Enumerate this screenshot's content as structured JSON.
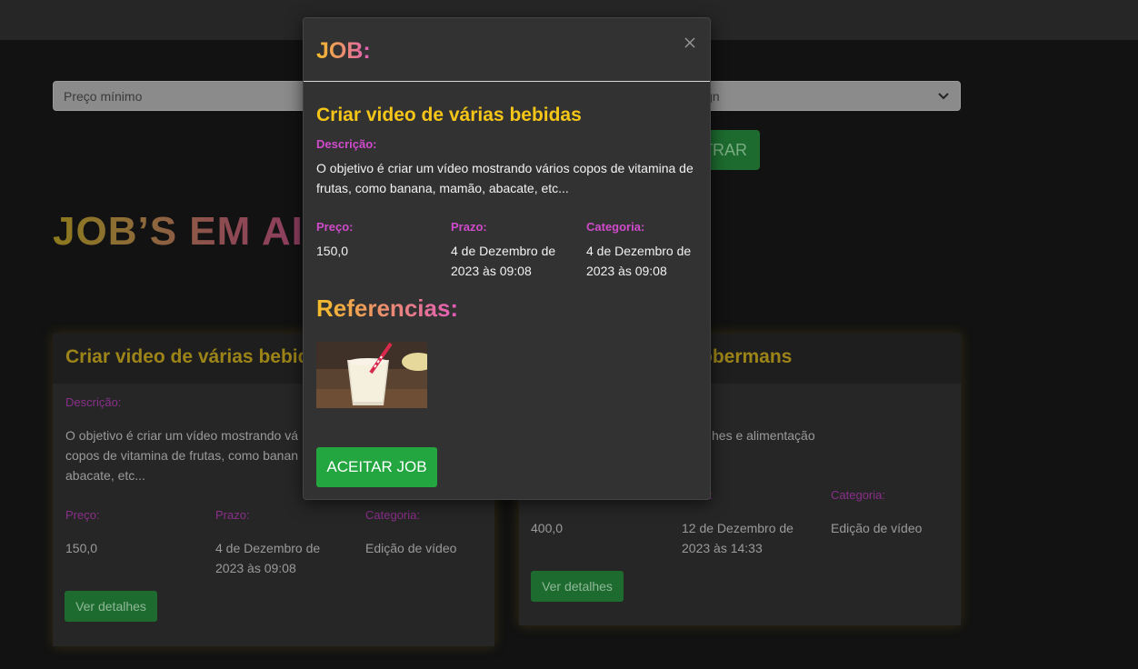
{
  "filters": {
    "min_price_placeholder": "Preço mínimo",
    "category_selected": "ign",
    "filter_button_label": "TRAR"
  },
  "page": {
    "heading": "JOB’S EM AI"
  },
  "cards": [
    {
      "title": "Criar video de várias bebidas",
      "description_label": "Descrição:",
      "description": "O objetivo é criar um vídeo mostrando vários copos de vitamina de frutas, como banana, mamão, abacate, etc...",
      "description_lines": [
        "O objetivo é criar um vídeo mostrando vá",
        "copos de vitamina de frutas, como banan",
        "abacate, etc..."
      ],
      "price_label": "Preço:",
      "price": "150,0",
      "deadline_label": "Prazo:",
      "deadline": "4 de Dezembro de 2023 às 09:08",
      "category_label": "Categoria:",
      "category": "Edição de vídeo",
      "details_button": "Ver detalhes"
    },
    {
      "title": "obermans",
      "description_fragment": "hes e alimentação",
      "price_label_fragment": "",
      "price": "400,0",
      "deadline_label_fragment": "o:",
      "deadline": "12 de Dezembro de 2023 às 14:33",
      "category_label": "Categoria:",
      "category": "Edição de vídeo",
      "details_button": "Ver detalhes"
    }
  ],
  "modal": {
    "title": "JOB:",
    "close_glyph": "×",
    "job_title": "Criar video de várias bebidas",
    "description_label": "Descrição:",
    "description": "O objetivo é criar um vídeo mostrando vários copos de vitamina de frutas, como banana, mamão, abacate, etc...",
    "price_label": "Preço:",
    "price": "150,0",
    "deadline_label": "Prazo:",
    "deadline": "4 de Dezembro de 2023 às 09:08",
    "category_label": "Categoria:",
    "category": "4 de Dezembro de 2023 às 09:08",
    "references_title": "Referencias:",
    "accept_button": "ACEITAR JOB"
  },
  "colors": {
    "background": "#121212",
    "accent_yellow": "#f5c518",
    "accent_pink": "#d04bcb",
    "button_green": "#23a640"
  }
}
